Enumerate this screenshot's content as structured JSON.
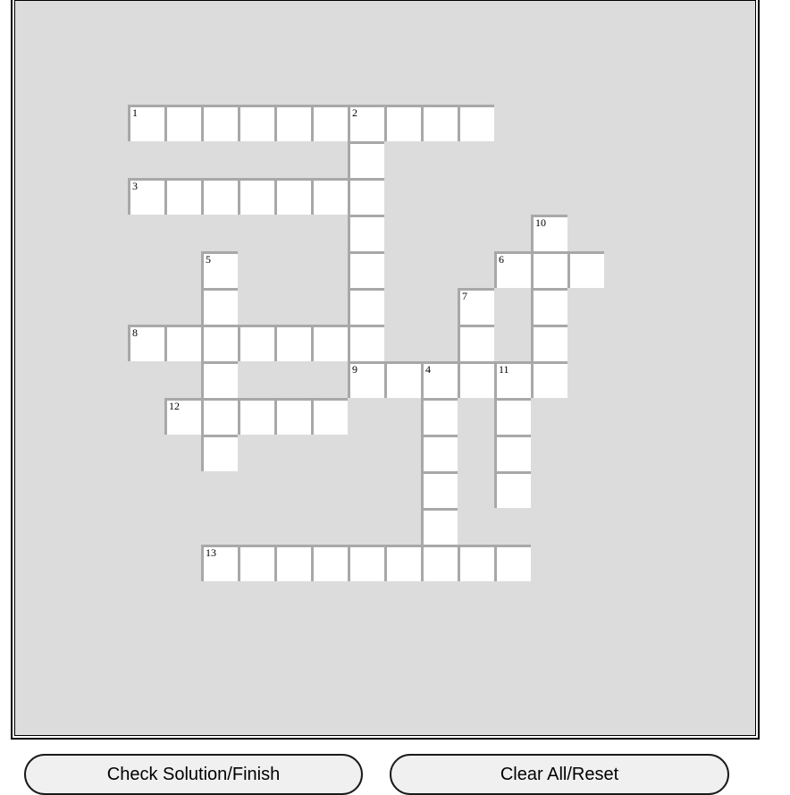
{
  "buttons": {
    "check": "Check Solution/Finish",
    "reset": "Clear All/Reset"
  },
  "clue_numbers": [
    "1",
    "2",
    "3",
    "4",
    "5",
    "6",
    "7",
    "8",
    "9",
    "10",
    "11",
    "12",
    "13"
  ]
}
